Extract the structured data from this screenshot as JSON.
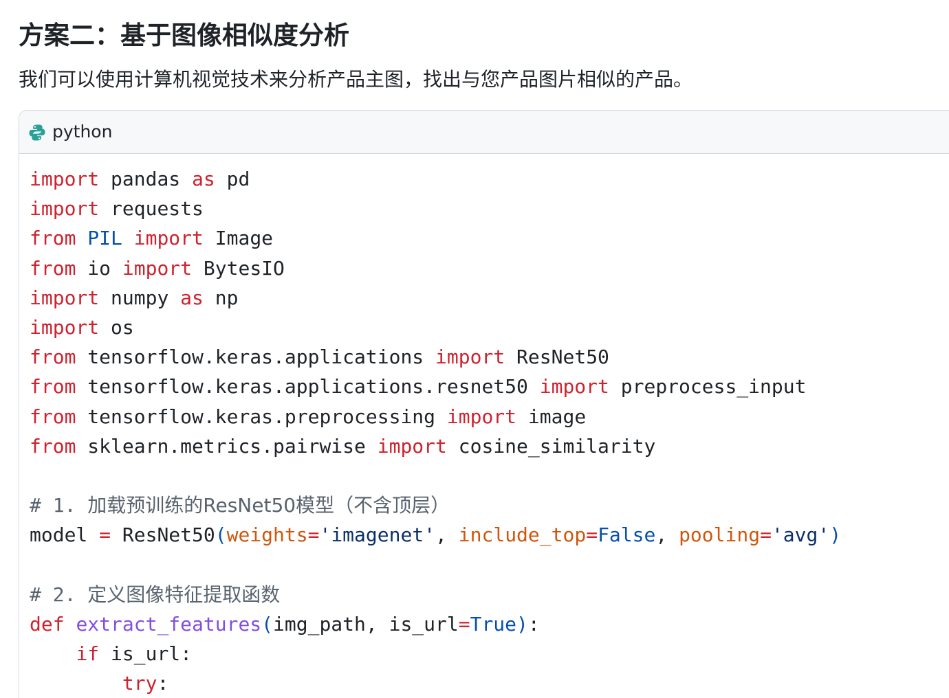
{
  "heading": "方案二：基于图像相似度分析",
  "intro": "我们可以使用计算机视觉技术来分析产品主图，找出与您产品图片相似的产品。",
  "code_block": {
    "language_icon": "python-icon",
    "language": "python",
    "lines": [
      [
        {
          "t": "import",
          "c": "kw"
        },
        {
          "t": " pandas "
        },
        {
          "t": "as",
          "c": "kw"
        },
        {
          "t": " pd"
        }
      ],
      [
        {
          "t": "import",
          "c": "kw"
        },
        {
          "t": " requests"
        }
      ],
      [
        {
          "t": "from",
          "c": "kw"
        },
        {
          "t": " "
        },
        {
          "t": "PIL",
          "c": "bl"
        },
        {
          "t": " "
        },
        {
          "t": "import",
          "c": "kw"
        },
        {
          "t": " Image"
        }
      ],
      [
        {
          "t": "from",
          "c": "kw"
        },
        {
          "t": " io "
        },
        {
          "t": "import",
          "c": "kw"
        },
        {
          "t": " BytesIO"
        }
      ],
      [
        {
          "t": "import",
          "c": "kw"
        },
        {
          "t": " numpy "
        },
        {
          "t": "as",
          "c": "kw"
        },
        {
          "t": " np"
        }
      ],
      [
        {
          "t": "import",
          "c": "kw"
        },
        {
          "t": " os"
        }
      ],
      [
        {
          "t": "from",
          "c": "kw"
        },
        {
          "t": " tensorflow.keras.applications "
        },
        {
          "t": "import",
          "c": "kw"
        },
        {
          "t": " ResNet50"
        }
      ],
      [
        {
          "t": "from",
          "c": "kw"
        },
        {
          "t": " tensorflow.keras.applications.resnet50 "
        },
        {
          "t": "import",
          "c": "kw"
        },
        {
          "t": " preprocess_input"
        }
      ],
      [
        {
          "t": "from",
          "c": "kw"
        },
        {
          "t": " tensorflow.keras.preprocessing "
        },
        {
          "t": "import",
          "c": "kw"
        },
        {
          "t": " image"
        }
      ],
      [
        {
          "t": "from",
          "c": "kw"
        },
        {
          "t": " sklearn.metrics.pairwise "
        },
        {
          "t": "import",
          "c": "kw"
        },
        {
          "t": " cosine_similarity"
        }
      ],
      [],
      [
        {
          "t": "# 1. ",
          "c": "cm"
        },
        {
          "t": "加载预训练的ResNet50模型（不含顶层）",
          "c": "cm cjk"
        }
      ],
      [
        {
          "t": "model "
        },
        {
          "t": "=",
          "c": "kw"
        },
        {
          "t": " ResNet50"
        },
        {
          "t": "(",
          "c": "bl"
        },
        {
          "t": "weights",
          "c": "or"
        },
        {
          "t": "=",
          "c": "kw"
        },
        {
          "t": "'imagenet'",
          "c": "st"
        },
        {
          "t": ", "
        },
        {
          "t": "include_top",
          "c": "or"
        },
        {
          "t": "=",
          "c": "kw"
        },
        {
          "t": "False",
          "c": "bl"
        },
        {
          "t": ", "
        },
        {
          "t": "pooling",
          "c": "or"
        },
        {
          "t": "=",
          "c": "kw"
        },
        {
          "t": "'avg'",
          "c": "st"
        },
        {
          "t": ")",
          "c": "bl"
        }
      ],
      [],
      [
        {
          "t": "# 2. ",
          "c": "cm"
        },
        {
          "t": "定义图像特征提取函数",
          "c": "cm cjk"
        }
      ],
      [
        {
          "t": "def",
          "c": "kw"
        },
        {
          "t": " "
        },
        {
          "t": "extract_features",
          "c": "pu"
        },
        {
          "t": "(",
          "c": "bl"
        },
        {
          "t": "img_path, is_url"
        },
        {
          "t": "=",
          "c": "kw"
        },
        {
          "t": "True",
          "c": "bl"
        },
        {
          "t": ")",
          "c": "bl"
        },
        {
          "t": ":"
        }
      ],
      [
        {
          "t": "    "
        },
        {
          "t": "if",
          "c": "kw"
        },
        {
          "t": " is_url:"
        }
      ],
      [
        {
          "t": "        "
        },
        {
          "t": "try",
          "c": "kw"
        },
        {
          "t": ":"
        }
      ]
    ]
  },
  "colors": {
    "keyword": "#cf222e",
    "builtin": "#0550ae",
    "parameter": "#d1560b",
    "function": "#8250df",
    "string": "#0a3069",
    "comment": "#59636e",
    "python_blue": "#3572A5",
    "python_teal": "#2aa198"
  }
}
